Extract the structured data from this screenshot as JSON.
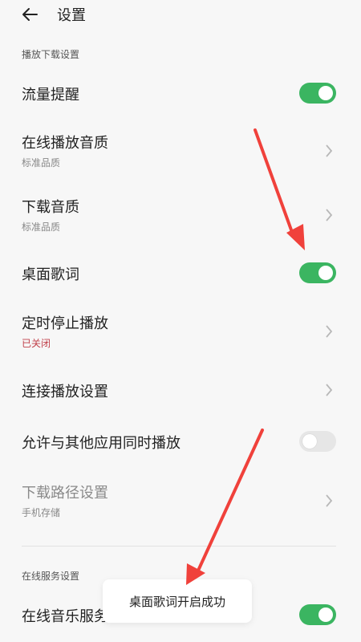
{
  "header": {
    "title": "设置",
    "back_icon": "arrow-left-icon"
  },
  "sections": {
    "playback_download": "播放下载设置",
    "online_service": "在线服务设置"
  },
  "rows": {
    "traffic_alert": {
      "title": "流量提醒",
      "enabled": true
    },
    "online_quality": {
      "title": "在线播放音质",
      "subtitle": "标准品质"
    },
    "download_quality": {
      "title": "下载音质",
      "subtitle": "标准品质"
    },
    "desktop_lyrics": {
      "title": "桌面歌词",
      "enabled": true
    },
    "sleep_timer": {
      "title": "定时停止播放",
      "subtitle": "已关闭",
      "subtitle_color": "#c0414b"
    },
    "connected_playback": {
      "title": "连接播放设置"
    },
    "allow_other_apps": {
      "title": "允许与其他应用同时播放",
      "enabled": false
    },
    "download_path": {
      "title": "下载路径设置",
      "subtitle": "手机存储"
    },
    "online_music_service": {
      "title": "在线音乐服务",
      "enabled": true
    }
  },
  "toast": {
    "text": "桌面歌词开启成功"
  },
  "colors": {
    "toggle_on": "#3bb561",
    "toggle_off": "#e6e6e6",
    "annotation_arrow": "#f0413b",
    "background": "#f7f7f7"
  }
}
